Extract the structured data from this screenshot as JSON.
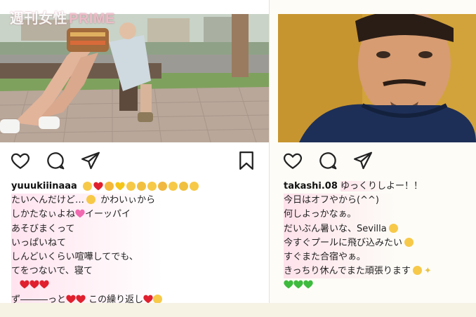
{
  "watermark": {
    "brand": "週刊女性",
    "prime": "PRIME"
  },
  "left_post": {
    "username": "yuuukiiinaaa",
    "caption_lines": [
      "たいへんだけど…",
      "かわいぃから",
      "しかたなぃよね",
      "イーッパイ",
      "あそびまくって",
      "いっぱいねて",
      "しんどいくらい喧嘩してでも、",
      "てをつないで、寝て",
      "ず―――っと",
      "この繰り返し"
    ]
  },
  "right_post": {
    "username": "takashi.08",
    "caption_lines": [
      "ゆっくりしよー！！",
      "今日はオフやから(^^)",
      "何しよっかなぁ。",
      "だいぶん暑いな、Sevilla",
      "今すぐプールに飛び込みたい",
      "すぐまた合宿やぁ。",
      "きっちり休んでまた頑張ります"
    ]
  },
  "colors": {
    "heart": "#e0202e",
    "yellow_heart": "#f5c518",
    "green_heart": "#3dbb3d",
    "emoji_face": "#f7c948",
    "highlight": "#ffcde1"
  },
  "icons": [
    "heart-icon",
    "comment-icon",
    "share-icon",
    "bookmark-icon"
  ]
}
